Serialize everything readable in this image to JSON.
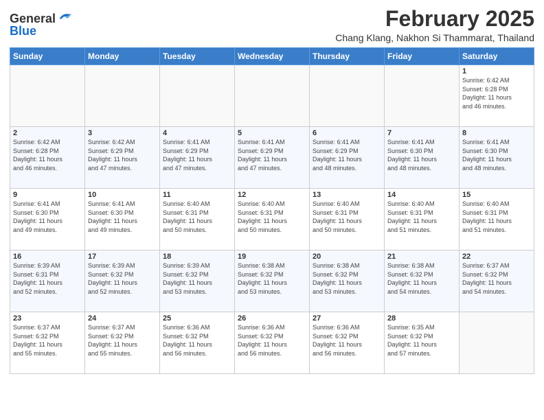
{
  "header": {
    "logo": {
      "general": "General",
      "blue": "Blue"
    },
    "title": "February 2025",
    "subtitle": "Chang Klang, Nakhon Si Thammarat, Thailand"
  },
  "calendar": {
    "headers": [
      "Sunday",
      "Monday",
      "Tuesday",
      "Wednesday",
      "Thursday",
      "Friday",
      "Saturday"
    ],
    "weeks": [
      [
        {
          "day": "",
          "info": ""
        },
        {
          "day": "",
          "info": ""
        },
        {
          "day": "",
          "info": ""
        },
        {
          "day": "",
          "info": ""
        },
        {
          "day": "",
          "info": ""
        },
        {
          "day": "",
          "info": ""
        },
        {
          "day": "1",
          "info": "Sunrise: 6:42 AM\nSunset: 6:28 PM\nDaylight: 11 hours\nand 46 minutes."
        }
      ],
      [
        {
          "day": "2",
          "info": "Sunrise: 6:42 AM\nSunset: 6:28 PM\nDaylight: 11 hours\nand 46 minutes."
        },
        {
          "day": "3",
          "info": "Sunrise: 6:42 AM\nSunset: 6:29 PM\nDaylight: 11 hours\nand 47 minutes."
        },
        {
          "day": "4",
          "info": "Sunrise: 6:41 AM\nSunset: 6:29 PM\nDaylight: 11 hours\nand 47 minutes."
        },
        {
          "day": "5",
          "info": "Sunrise: 6:41 AM\nSunset: 6:29 PM\nDaylight: 11 hours\nand 47 minutes."
        },
        {
          "day": "6",
          "info": "Sunrise: 6:41 AM\nSunset: 6:29 PM\nDaylight: 11 hours\nand 48 minutes."
        },
        {
          "day": "7",
          "info": "Sunrise: 6:41 AM\nSunset: 6:30 PM\nDaylight: 11 hours\nand 48 minutes."
        },
        {
          "day": "8",
          "info": "Sunrise: 6:41 AM\nSunset: 6:30 PM\nDaylight: 11 hours\nand 48 minutes."
        }
      ],
      [
        {
          "day": "9",
          "info": "Sunrise: 6:41 AM\nSunset: 6:30 PM\nDaylight: 11 hours\nand 49 minutes."
        },
        {
          "day": "10",
          "info": "Sunrise: 6:41 AM\nSunset: 6:30 PM\nDaylight: 11 hours\nand 49 minutes."
        },
        {
          "day": "11",
          "info": "Sunrise: 6:40 AM\nSunset: 6:31 PM\nDaylight: 11 hours\nand 50 minutes."
        },
        {
          "day": "12",
          "info": "Sunrise: 6:40 AM\nSunset: 6:31 PM\nDaylight: 11 hours\nand 50 minutes."
        },
        {
          "day": "13",
          "info": "Sunrise: 6:40 AM\nSunset: 6:31 PM\nDaylight: 11 hours\nand 50 minutes."
        },
        {
          "day": "14",
          "info": "Sunrise: 6:40 AM\nSunset: 6:31 PM\nDaylight: 11 hours\nand 51 minutes."
        },
        {
          "day": "15",
          "info": "Sunrise: 6:40 AM\nSunset: 6:31 PM\nDaylight: 11 hours\nand 51 minutes."
        }
      ],
      [
        {
          "day": "16",
          "info": "Sunrise: 6:39 AM\nSunset: 6:31 PM\nDaylight: 11 hours\nand 52 minutes."
        },
        {
          "day": "17",
          "info": "Sunrise: 6:39 AM\nSunset: 6:32 PM\nDaylight: 11 hours\nand 52 minutes."
        },
        {
          "day": "18",
          "info": "Sunrise: 6:39 AM\nSunset: 6:32 PM\nDaylight: 11 hours\nand 53 minutes."
        },
        {
          "day": "19",
          "info": "Sunrise: 6:38 AM\nSunset: 6:32 PM\nDaylight: 11 hours\nand 53 minutes."
        },
        {
          "day": "20",
          "info": "Sunrise: 6:38 AM\nSunset: 6:32 PM\nDaylight: 11 hours\nand 53 minutes."
        },
        {
          "day": "21",
          "info": "Sunrise: 6:38 AM\nSunset: 6:32 PM\nDaylight: 11 hours\nand 54 minutes."
        },
        {
          "day": "22",
          "info": "Sunrise: 6:37 AM\nSunset: 6:32 PM\nDaylight: 11 hours\nand 54 minutes."
        }
      ],
      [
        {
          "day": "23",
          "info": "Sunrise: 6:37 AM\nSunset: 6:32 PM\nDaylight: 11 hours\nand 55 minutes."
        },
        {
          "day": "24",
          "info": "Sunrise: 6:37 AM\nSunset: 6:32 PM\nDaylight: 11 hours\nand 55 minutes."
        },
        {
          "day": "25",
          "info": "Sunrise: 6:36 AM\nSunset: 6:32 PM\nDaylight: 11 hours\nand 56 minutes."
        },
        {
          "day": "26",
          "info": "Sunrise: 6:36 AM\nSunset: 6:32 PM\nDaylight: 11 hours\nand 56 minutes."
        },
        {
          "day": "27",
          "info": "Sunrise: 6:36 AM\nSunset: 6:32 PM\nDaylight: 11 hours\nand 56 minutes."
        },
        {
          "day": "28",
          "info": "Sunrise: 6:35 AM\nSunset: 6:32 PM\nDaylight: 11 hours\nand 57 minutes."
        },
        {
          "day": "",
          "info": ""
        }
      ]
    ]
  }
}
